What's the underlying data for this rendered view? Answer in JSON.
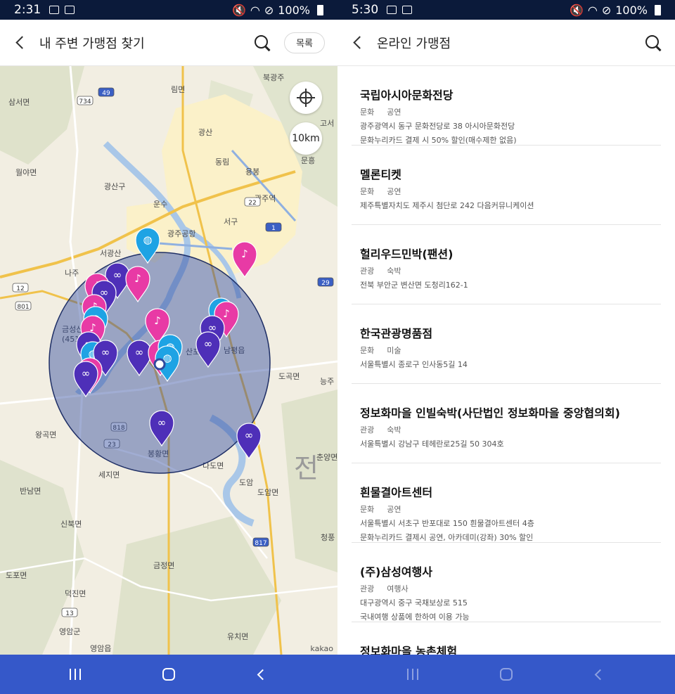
{
  "left": {
    "status": {
      "time": "2:31",
      "battery": "100%"
    },
    "appbar": {
      "title": "내 주변 가맹점 찾기",
      "list_label": "목록"
    },
    "map": {
      "scale_label": "10km",
      "attribution": "kakao",
      "place_labels": [
        {
          "text": "삼서면"
        },
        {
          "text": "월야면"
        },
        {
          "text": "광산구"
        },
        {
          "text": "서구"
        },
        {
          "text": "나주"
        },
        {
          "text": "금성산"
        },
        {
          "text": "(451)"
        },
        {
          "text": "남평읍"
        },
        {
          "text": "산포"
        },
        {
          "text": "도곡면"
        },
        {
          "text": "왕곡면"
        },
        {
          "text": "봉황면"
        },
        {
          "text": "다도면"
        },
        {
          "text": "세지면"
        },
        {
          "text": "반남면"
        },
        {
          "text": "도암면"
        },
        {
          "text": "신북면"
        },
        {
          "text": "금정면"
        },
        {
          "text": "도포면"
        },
        {
          "text": "덕진면"
        },
        {
          "text": "영암군"
        },
        {
          "text": "영암읍"
        },
        {
          "text": "유치면"
        },
        {
          "text": "청풍"
        },
        {
          "text": "광주역"
        },
        {
          "text": "광주공항"
        },
        {
          "text": "광산"
        },
        {
          "text": "동림"
        },
        {
          "text": "용봉"
        },
        {
          "text": "북광주"
        },
        {
          "text": "림면"
        },
        {
          "text": "고서"
        },
        {
          "text": "문흥"
        },
        {
          "text": "서광산"
        },
        {
          "text": "도암"
        },
        {
          "text": "능주"
        },
        {
          "text": "춘양면"
        },
        {
          "text": "운수"
        },
        {
          "text": "전"
        }
      ],
      "road_labels": [
        {
          "text": "49"
        },
        {
          "text": "734"
        },
        {
          "text": "22"
        },
        {
          "text": "1"
        },
        {
          "text": "12"
        },
        {
          "text": "801"
        },
        {
          "text": "29"
        },
        {
          "text": "818"
        },
        {
          "text": "23"
        },
        {
          "text": "817"
        },
        {
          "text": "13"
        }
      ]
    },
    "colors": {
      "pin_blue": "#1ea3e4",
      "pin_pink": "#e83aa5",
      "pin_purple": "#4e2fb8",
      "radius_fill": "#2f4a9e"
    }
  },
  "right": {
    "status": {
      "time": "5:30",
      "battery": "100%"
    },
    "appbar": {
      "title": "온라인 가맹점"
    },
    "items": [
      {
        "name": "국립아시아문화전당",
        "category": "문화",
        "subcategory": "공연",
        "address": "광주광역시 동구 문화전당로 38 아시아문화전당",
        "note": "문화누리카드 결제 시 50% 할인(매수제한 없음)"
      },
      {
        "name": "멜론티켓",
        "category": "문화",
        "subcategory": "공연",
        "address": "제주특별자치도 제주시 첨단로 242 다음커뮤니케이션",
        "note": ""
      },
      {
        "name": "헐리우드민박(팬션)",
        "category": "관광",
        "subcategory": "숙박",
        "address": "전북 부안군 변산면 도청리162-1",
        "note": ""
      },
      {
        "name": "한국관광명품점",
        "category": "문화",
        "subcategory": "미술",
        "address": "서울특별시 종로구 인사동5길 14",
        "note": ""
      },
      {
        "name": "정보화마을 인빌숙박(사단법인 정보화마을 중앙협의회)",
        "category": "관광",
        "subcategory": "숙박",
        "address": "서울특별시 강남구 테헤란로25길 50 304호",
        "note": ""
      },
      {
        "name": "흰물결아트센터",
        "category": "문화",
        "subcategory": "공연",
        "address": "서울특별시 서초구 반포대로 150 흰물결아트센터 4층",
        "note": "문화누리카드 결제시 공연, 아카데미(강좌) 30% 할인"
      },
      {
        "name": "(주)삼성여행사",
        "category": "관광",
        "subcategory": "여행사",
        "address": "대구광역시 중구 국채보상로 515",
        "note": "국내여행 상품에 한하여 이용 가능"
      },
      {
        "name": "정보화마을 농촌체험",
        "category": "",
        "subcategory": "",
        "address": "",
        "note": ""
      }
    ]
  }
}
